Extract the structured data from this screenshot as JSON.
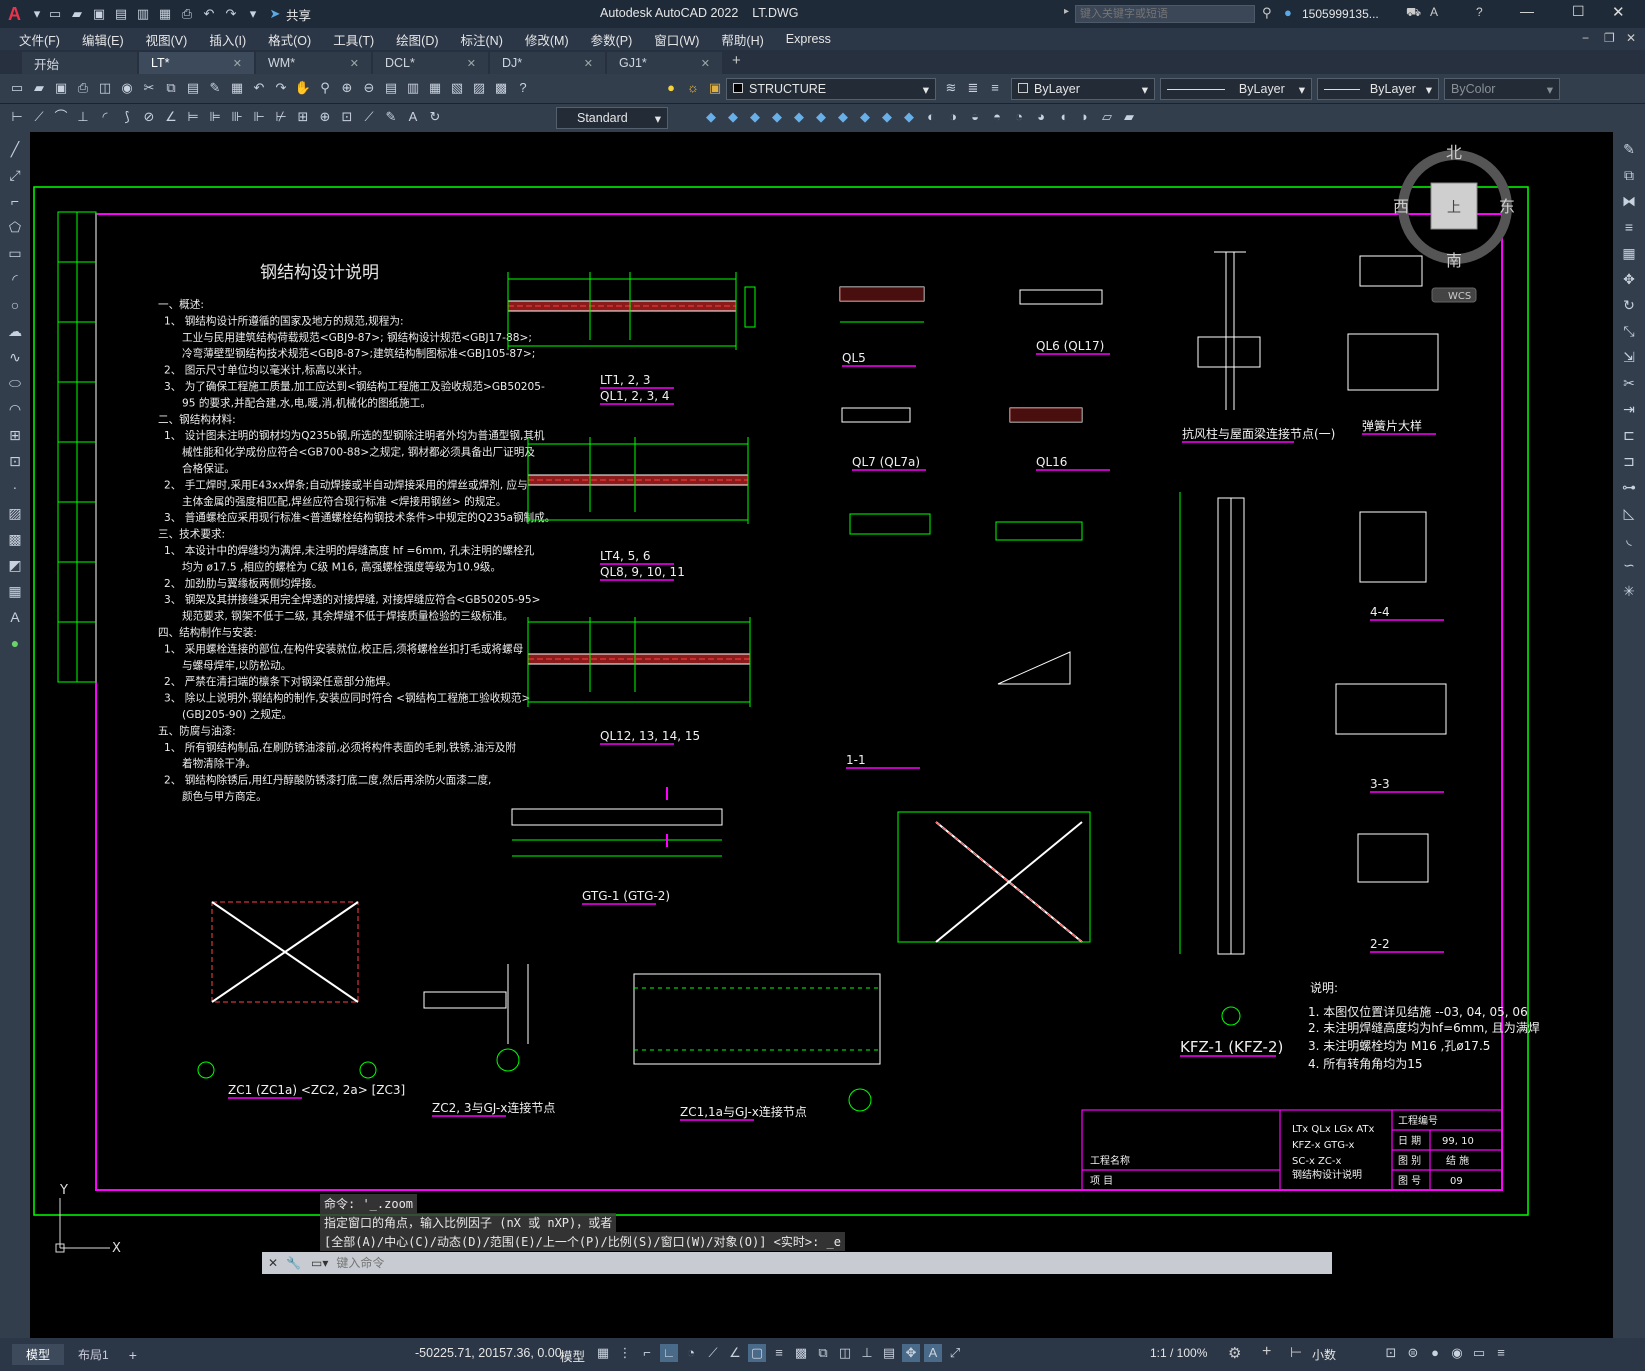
{
  "app": {
    "title": "Autodesk AutoCAD 2022",
    "file": "LT.DWG",
    "share_label": "共享",
    "search_placeholder": "键入关键字或短语",
    "user": "1505999135..."
  },
  "menu": [
    "文件(F)",
    "编辑(E)",
    "视图(V)",
    "插入(I)",
    "格式(O)",
    "工具(T)",
    "绘图(D)",
    "标注(N)",
    "修改(M)",
    "参数(P)",
    "窗口(W)",
    "帮助(H)",
    "Express"
  ],
  "tabs": [
    {
      "label": "开始",
      "closable": false
    },
    {
      "label": "LT*",
      "closable": true,
      "active": true
    },
    {
      "label": "WM*",
      "closable": true
    },
    {
      "label": "DCL*",
      "closable": true
    },
    {
      "label": "DJ*",
      "closable": true
    },
    {
      "label": "GJ1*",
      "closable": true
    }
  ],
  "toolbar": {
    "layer": "STRUCTURE",
    "color": "ByLayer",
    "linetype": "ByLayer",
    "lineweight": "ByLayer",
    "plotstyle": "ByColor",
    "textstyle": "Standard"
  },
  "viewcube": {
    "north": "北",
    "south": "南",
    "east": "东",
    "west": "西",
    "top": "上",
    "wcs": "WCS"
  },
  "ucs": {
    "x": "X",
    "y": "Y"
  },
  "command": {
    "history": [
      "命令: '_.zoom",
      "指定窗口的角点，输入比例因子 (nX 或 nXP)，或者",
      "[全部(A)/中心(C)/动态(D)/范围(E)/上一个(P)/比例(S)/窗口(W)/对象(O)] <实时>: _e"
    ],
    "placeholder": "键入命令"
  },
  "status": {
    "model_tab": "模型",
    "layout_tab": "布局1",
    "coords": "-50225.71, 20157.36, 0.00",
    "model_btn": "模型",
    "scale": "1:1 / 100%",
    "units": "小数"
  },
  "drawing": {
    "main_title": "钢结构设计说明",
    "notes": [
      "一、概述:",
      "1、 钢结构设计所遵循的国家及地方的规范,规程为:",
      "工业与民用建筑结构荷载规范<GBJ9-87>; 钢结构设计规范<GBJ17-88>;",
      "冷弯薄壁型钢结构技术规范<GBJ8-87>;建筑结构制图标准<GBJ105-87>;",
      "2、 图示尺寸单位均以毫米计,标高以米计。",
      "3、 为了确保工程施工质量,加工应达到<钢结构工程施工及验收规范>GB50205-",
      "95 的要求,并配合建,水,电,暖,消,机械化的图纸施工。",
      "二、钢结构材料:",
      "1、 设计图未注明的钢材均为Q235b钢,所选的型钢除注明者外均为普通型钢,其机",
      "械性能和化学成份应符合<GB700-88>之规定, 钢材都必须具备出厂证明及",
      "合格保证。",
      "2、 手工焊时,采用E43xx焊条;自动焊接或半自动焊接采用的焊丝或焊剂, 应与",
      "主体金属的强度相匹配,焊丝应符合现行标准 <焊接用钢丝> 的规定。",
      "3、 普通螺栓应采用现行标准<普通螺栓结构钢技术条件>中规定的Q235a钢制成。",
      "三、技术要求:",
      "1、 本设计中的焊缝均为满焊,未注明的焊缝高度 hf =6mm, 孔未注明的螺栓孔",
      "均为 ø17.5 ,相应的螺栓为 C级 M16, 高强螺栓强度等级为10.9级。",
      "2、 加劲肋与翼缘板两侧均焊接。",
      "3、 钢架及其拼接缝采用完全焊透的对接焊缝, 对接焊缝应符合<GB50205-95>",
      "规范要求, 钢架不低于二级, 其余焊缝不低于焊接质量检验的三级标准。",
      "四、结构制作与安装:",
      "1、 采用螺栓连接的部位,在构件安装就位,校正后,须将螺栓丝扣打毛或将螺母",
      "与螺母焊牢,以防松动。",
      "2、 严禁在清扫端的檩条下对钢梁任意部分施焊。",
      "3、 除以上说明外,钢结构的制作,安装应同时符合 <钢结构工程施工验收规范>",
      "(GBJ205-90) 之规定。",
      "五、防腐与油漆:",
      "1、 所有钢结构制品,在刷防锈油漆前,必须将构件表面的毛刺,铁锈,油污及附",
      "着物清除干净。",
      "2、 钢结构除锈后,用红丹醇酸防锈漆打底二度,然后再涂防火面漆二度,",
      "颜色与甲方商定。"
    ],
    "labels": [
      {
        "t": "LT1, 2, 3"
      },
      {
        "t": "QL1, 2, 3, 4"
      },
      {
        "t": "LT4, 5, 6"
      },
      {
        "t": "QL8, 9, 10, 11"
      },
      {
        "t": "QL12, 13, 14, 15"
      },
      {
        "t": "GTG-1 (GTG-2)"
      },
      {
        "t": "QL5"
      },
      {
        "t": "QL6 (QL17)"
      },
      {
        "t": "QL7 (QL7a)"
      },
      {
        "t": "QL16"
      },
      {
        "t": "抗风柱与屋面梁连接节点(一)"
      },
      {
        "t": "弹簧片大样"
      },
      {
        "t": "ZC1 (ZC1a) <ZC2, 2a> [ZC3]"
      },
      {
        "t": "ZC2, 3与GJ-x连接节点"
      },
      {
        "t": "ZC1,1a与GJ-x连接节点"
      },
      {
        "t": "KFZ-1 (KFZ-2)"
      },
      {
        "t": "4-4"
      },
      {
        "t": "3-3"
      },
      {
        "t": "2-2"
      },
      {
        "t": "1-1"
      }
    ],
    "right_notes_title": "说明:",
    "right_notes": [
      "1. 本图仅位置详见结施 --03, 04, 05, 06",
      "2. 未注明焊缝高度均为hf=6mm, 且为满焊",
      "3. 未注明螺栓均为 M16 ,孔ø17.5",
      "4. 所有转角角均为15"
    ],
    "title_block": {
      "drawing_list": [
        "LTx  QLx  LGx  ATx",
        "KFZ-x  GTG-x",
        "SC-x   ZC-x",
        "钢结构设计说明"
      ],
      "project_name_label": "工程名称",
      "item_label": "项   目",
      "number_label": "工程编号",
      "date_label": "日   期",
      "date": "99, 10",
      "type_label": "图   别",
      "type": "结 施",
      "no_label": "图   号",
      "no": "09"
    }
  }
}
